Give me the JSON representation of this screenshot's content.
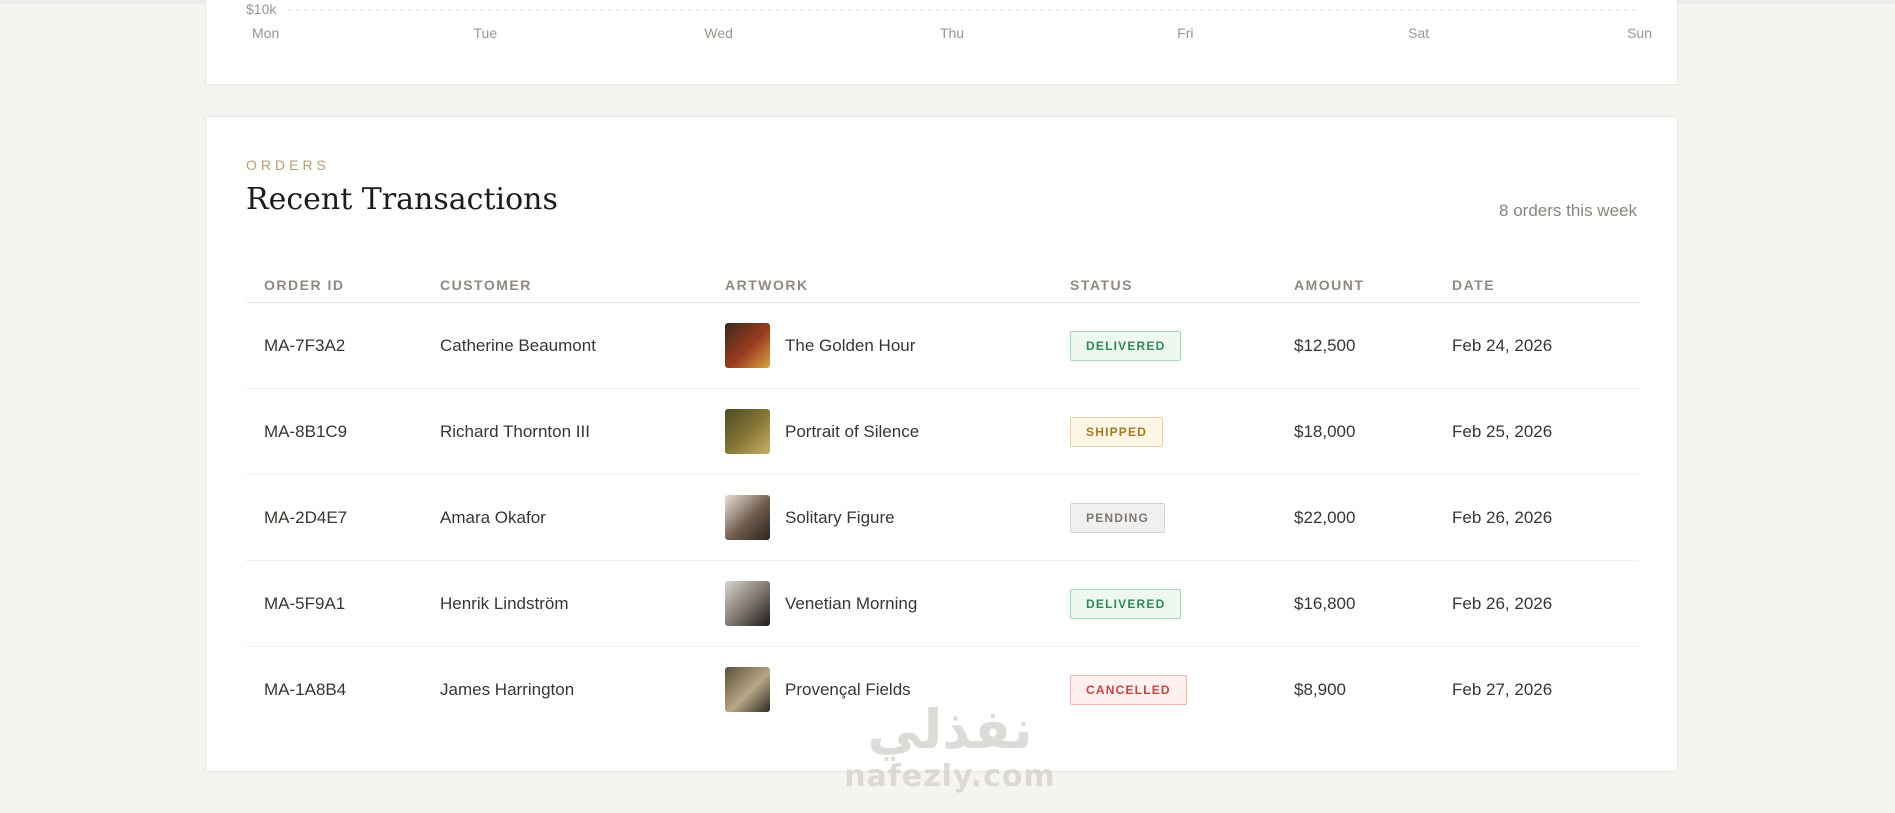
{
  "chart": {
    "y_tick_label": "$10k",
    "days": [
      "Mon",
      "Tue",
      "Wed",
      "Thu",
      "Fri",
      "Sat",
      "Sun"
    ]
  },
  "orders": {
    "eyebrow": "ORDERS",
    "title": "Recent Transactions",
    "week_count": "8 orders this week",
    "columns": [
      "ORDER ID",
      "CUSTOMER",
      "ARTWORK",
      "STATUS",
      "AMOUNT",
      "DATE"
    ],
    "rows": [
      {
        "order_id": "MA-7F3A2",
        "customer": "Catherine Beaumont",
        "artwork": "The Golden Hour",
        "status": "DELIVERED",
        "amount": "$12,500",
        "date": "Feb 24, 2026",
        "thumb_colors": [
          "#3b2a1c",
          "#9c3b1f",
          "#d9a441"
        ]
      },
      {
        "order_id": "MA-8B1C9",
        "customer": "Richard Thornton III",
        "artwork": "Portrait of Silence",
        "status": "SHIPPED",
        "amount": "$18,000",
        "date": "Feb 25, 2026",
        "thumb_colors": [
          "#4a4a22",
          "#8a7a3a",
          "#c9b06a"
        ]
      },
      {
        "order_id": "MA-2D4E7",
        "customer": "Amara Okafor",
        "artwork": "Solitary Figure",
        "status": "PENDING",
        "amount": "$22,000",
        "date": "Feb 26, 2026",
        "thumb_colors": [
          "#e9e1d6",
          "#6d5a4c",
          "#2d2520"
        ]
      },
      {
        "order_id": "MA-5F9A1",
        "customer": "Henrik Lindström",
        "artwork": "Venetian Morning",
        "status": "DELIVERED",
        "amount": "$16,800",
        "date": "Feb 26, 2026",
        "thumb_colors": [
          "#d8d4cf",
          "#7a736b",
          "#1e1c1a"
        ]
      },
      {
        "order_id": "MA-1A8B4",
        "customer": "James Harrington",
        "artwork": "Provençal Fields",
        "status": "CANCELLED",
        "amount": "$8,900",
        "date": "Feb 27, 2026",
        "thumb_colors": [
          "#5a5038",
          "#b8a784",
          "#2e2a20"
        ]
      }
    ]
  },
  "status_styles": {
    "DELIVERED": {
      "text": "#2f8a57",
      "bg": "#eef7f0",
      "border": "#a9d6b8"
    },
    "SHIPPED": {
      "text": "#a8781c",
      "bg": "#fdf5e6",
      "border": "#ecd09a"
    },
    "PENDING": {
      "text": "#7d7874",
      "bg": "#f1f0ee",
      "border": "#d6d3cf"
    },
    "CANCELLED": {
      "text": "#c0463f",
      "bg": "#fdf0ef",
      "border": "#eeb5b1"
    }
  },
  "colors": {
    "accent": "#b69b73",
    "page_background": "#f6f4f1",
    "card_background": "#ffffff"
  },
  "watermark": {
    "arabic": "نفذلي",
    "latin": "nafezly.com"
  }
}
